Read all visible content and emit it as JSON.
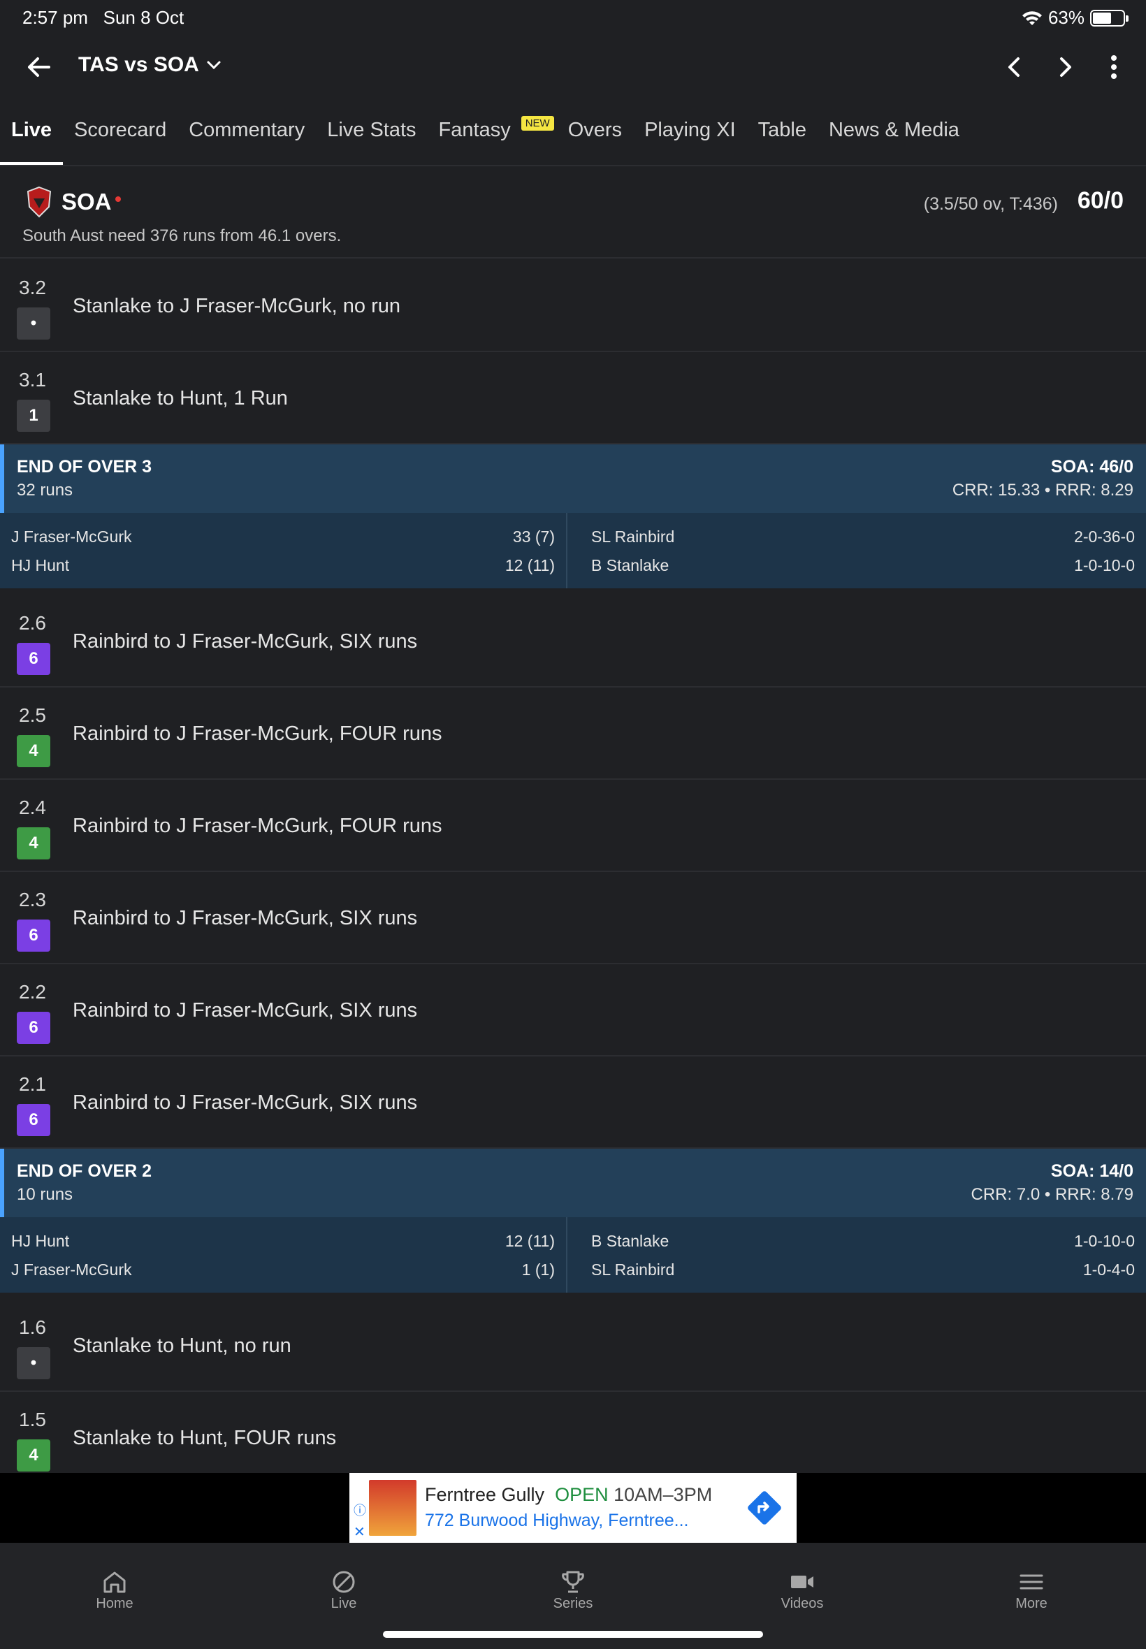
{
  "status_bar": {
    "time": "2:57 pm",
    "date": "Sun 8 Oct",
    "battery": "63%"
  },
  "header": {
    "title": "TAS vs SOA"
  },
  "tabs": [
    {
      "label": "Live",
      "active": true
    },
    {
      "label": "Scorecard"
    },
    {
      "label": "Commentary"
    },
    {
      "label": "Live Stats"
    },
    {
      "label": "Fantasy",
      "badge": "NEW"
    },
    {
      "label": "Overs"
    },
    {
      "label": "Playing XI"
    },
    {
      "label": "Table"
    },
    {
      "label": "News & Media"
    }
  ],
  "score": {
    "team": "SOA",
    "overs_info": "(3.5/50 ov, T:436)",
    "total": "60/0",
    "need": "South Aust need 376 runs from 46.1 overs."
  },
  "balls_a": [
    {
      "over": "3.2",
      "badge": "•",
      "type": "dot",
      "text": "Stanlake to J Fraser-McGurk, no run"
    },
    {
      "over": "3.1",
      "badge": "1",
      "type": "run",
      "text": "Stanlake to Hunt, 1 Run"
    }
  ],
  "over3": {
    "title": "END OF OVER 3",
    "runs": "32 runs",
    "score": "SOA: 46/0",
    "rates": "CRR: 15.33 • RRR: 8.29",
    "batters": [
      {
        "name": "J Fraser-McGurk",
        "stat": "33 (7)"
      },
      {
        "name": "HJ Hunt",
        "stat": "12 (11)"
      }
    ],
    "bowlers": [
      {
        "name": "SL Rainbird",
        "stat": "2-0-36-0"
      },
      {
        "name": "B Stanlake",
        "stat": "1-0-10-0"
      }
    ]
  },
  "balls_b": [
    {
      "over": "2.6",
      "badge": "6",
      "type": "six",
      "text": "Rainbird to J Fraser-McGurk, SIX runs"
    },
    {
      "over": "2.5",
      "badge": "4",
      "type": "four",
      "text": "Rainbird to J Fraser-McGurk, FOUR runs"
    },
    {
      "over": "2.4",
      "badge": "4",
      "type": "four",
      "text": "Rainbird to J Fraser-McGurk, FOUR runs"
    },
    {
      "over": "2.3",
      "badge": "6",
      "type": "six",
      "text": "Rainbird to J Fraser-McGurk, SIX runs"
    },
    {
      "over": "2.2",
      "badge": "6",
      "type": "six",
      "text": "Rainbird to J Fraser-McGurk, SIX runs"
    },
    {
      "over": "2.1",
      "badge": "6",
      "type": "six",
      "text": "Rainbird to J Fraser-McGurk, SIX runs"
    }
  ],
  "over2": {
    "title": "END OF OVER 2",
    "runs": "10 runs",
    "score": "SOA: 14/0",
    "rates": "CRR: 7.0 • RRR: 8.79",
    "batters": [
      {
        "name": "HJ Hunt",
        "stat": "12 (11)"
      },
      {
        "name": "J Fraser-McGurk",
        "stat": "1 (1)"
      }
    ],
    "bowlers": [
      {
        "name": "B Stanlake",
        "stat": "1-0-10-0"
      },
      {
        "name": "SL Rainbird",
        "stat": "1-0-4-0"
      }
    ]
  },
  "balls_c": [
    {
      "over": "1.6",
      "badge": "•",
      "type": "dot",
      "text": "Stanlake to Hunt, no run"
    },
    {
      "over": "1.5",
      "badge": "4",
      "type": "four",
      "text": "Stanlake to Hunt, FOUR runs"
    }
  ],
  "ad": {
    "name": "Ferntree Gully",
    "open": "OPEN",
    "hours": "10AM–3PM",
    "address": "772 Burwood Highway, Ferntree..."
  },
  "nav": [
    {
      "label": "Home",
      "icon": "home-icon"
    },
    {
      "label": "Live",
      "icon": "live-icon"
    },
    {
      "label": "Series",
      "icon": "trophy-icon"
    },
    {
      "label": "Videos",
      "icon": "video-icon"
    },
    {
      "label": "More",
      "icon": "menu-icon"
    }
  ],
  "colors": {
    "six": "#7b3fe4",
    "four": "#3e9b45",
    "dot": "#3d3e42",
    "over_summary": "#234059",
    "live_dot": "#e53935"
  }
}
